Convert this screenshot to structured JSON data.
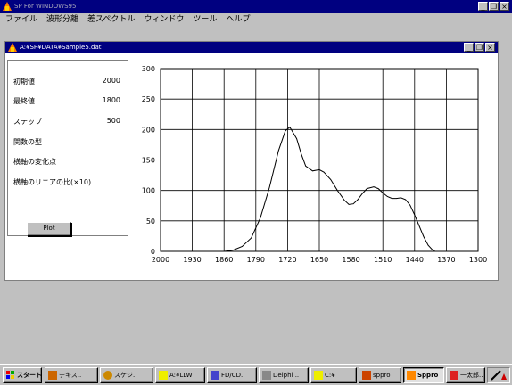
{
  "app": {
    "title": "SP For WINDOWS95"
  },
  "window_buttons": {
    "minimize": "_",
    "restore": "❐",
    "close": "×"
  },
  "menu": {
    "items": [
      "ファイル",
      "波形分離",
      "差スペクトル",
      "ウィンドウ",
      "ツール",
      "ヘルプ"
    ]
  },
  "document": {
    "title": "A:¥SP¥DATA¥Sample5.dat"
  },
  "params": [
    {
      "label": "初期値",
      "value": "2000"
    },
    {
      "label": "最終値",
      "value": "1800"
    },
    {
      "label": "ステップ",
      "value": "500"
    },
    {
      "label": "関数の型",
      "value": ""
    },
    {
      "label": "横軸の変化点",
      "value": ""
    },
    {
      "label": "横軸のリニアの比(×10)",
      "value": ""
    }
  ],
  "plot_button": {
    "label": "Plot"
  },
  "chart_data": {
    "type": "line",
    "title": "",
    "xlabel": "",
    "ylabel": "",
    "xlim": [
      2000,
      1300
    ],
    "ylim": [
      0,
      300
    ],
    "x_ticks": [
      "2000",
      "1930",
      "1860",
      "1790",
      "1720",
      "1650",
      "1580",
      "1510",
      "1440",
      "1370",
      "1300"
    ],
    "y_ticks": [
      "0",
      "50",
      "100",
      "150",
      "200",
      "250",
      "300"
    ],
    "grid": true,
    "series": [
      {
        "color": "#000000",
        "x": [
          1860,
          1840,
          1820,
          1800,
          1780,
          1760,
          1740,
          1725,
          1715,
          1700,
          1690,
          1680,
          1665,
          1650,
          1640,
          1625,
          1610,
          1595,
          1585,
          1575,
          1565,
          1555,
          1545,
          1530,
          1520,
          1510,
          1500,
          1490,
          1480,
          1470,
          1460,
          1450,
          1440,
          1430,
          1420,
          1410,
          1400,
          1395
        ],
        "y": [
          0,
          2,
          8,
          22,
          55,
          105,
          165,
          198,
          204,
          185,
          160,
          140,
          132,
          134,
          130,
          118,
          100,
          84,
          77,
          78,
          85,
          95,
          103,
          106,
          103,
          96,
          90,
          87,
          87,
          88,
          85,
          76,
          60,
          42,
          24,
          10,
          2,
          0
        ]
      }
    ]
  },
  "taskbar": {
    "start": "スタート",
    "items": [
      "テキス..",
      "スケジ..",
      "A:¥LLW",
      "FD/CD..",
      "Delphi ..",
      "C:¥",
      "sppro",
      "Sppro",
      "一太郎.."
    ],
    "active_index": 7
  }
}
